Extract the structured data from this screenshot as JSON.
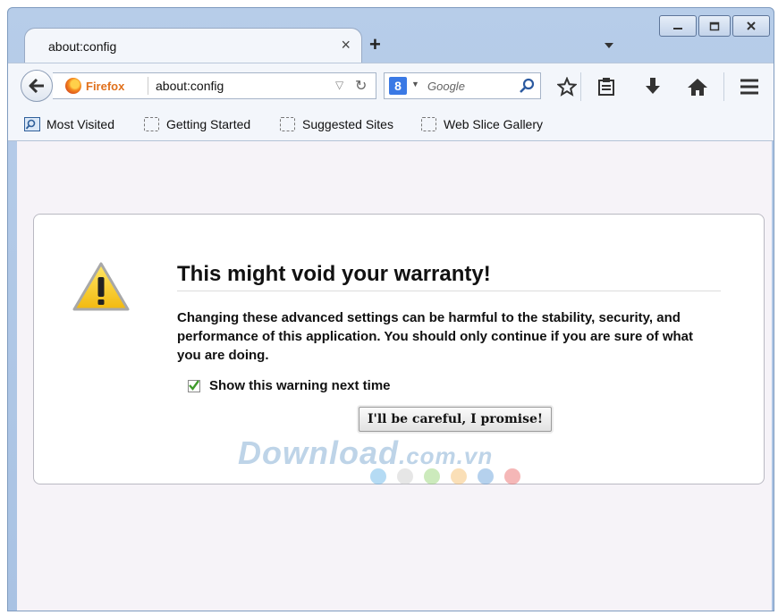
{
  "window": {
    "controls": [
      "minimize",
      "maximize",
      "close"
    ]
  },
  "tab": {
    "title": "about:config",
    "close_glyph": "×",
    "new_tab_glyph": "+"
  },
  "navbar": {
    "identity_label": "Firefox",
    "url": "about:config",
    "search_engine_letter": "8",
    "search_placeholder": "Google"
  },
  "bookmarks": [
    {
      "label": "Most Visited",
      "icon": "most-visited-icon"
    },
    {
      "label": "Getting Started",
      "icon": "bookmark-placeholder-icon"
    },
    {
      "label": "Suggested Sites",
      "icon": "bookmark-placeholder-icon"
    },
    {
      "label": "Web Slice Gallery",
      "icon": "bookmark-placeholder-icon"
    }
  ],
  "warning": {
    "title": "This might void your warranty!",
    "message": "Changing these advanced settings can be harmful to the stability, security, and performance of this application. You should only continue if you are sure of what you are doing.",
    "checkbox_label": "Show this warning next time",
    "checkbox_checked": true,
    "button_label": "I'll be careful, I promise!"
  },
  "watermark": {
    "brand": "Download",
    "domain": ".com.vn",
    "dot_colors": [
      "#5ab0e6",
      "#c8c8c8",
      "#8fd06a",
      "#f4b860",
      "#5b9ad6",
      "#e86060"
    ]
  },
  "colors": {
    "accent": "#3a79e5",
    "firefox_orange": "#e0701c",
    "check_green": "#3f9a2b"
  }
}
